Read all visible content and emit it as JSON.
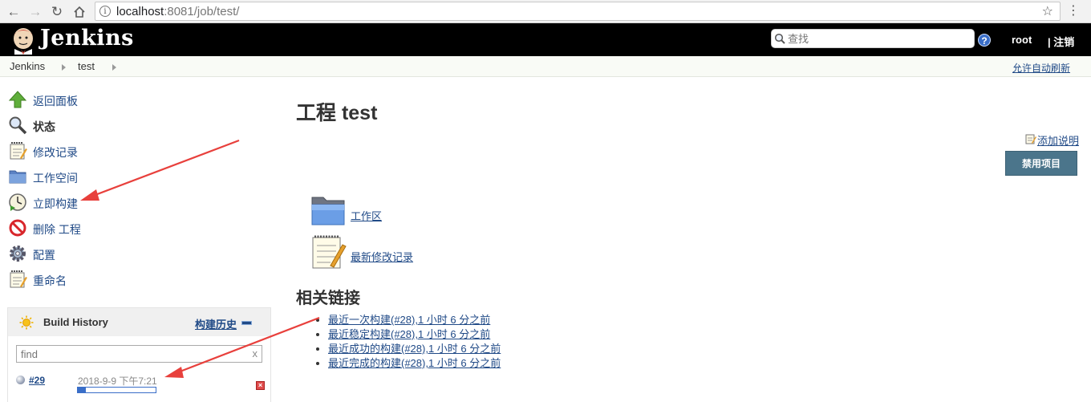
{
  "browser": {
    "url_host": "localhost",
    "url_rest": ":8081/job/test/"
  },
  "header": {
    "logo_text": "Jenkins",
    "search_placeholder": "查找",
    "help_label": "?",
    "user": "root",
    "logout": "| 注销"
  },
  "breadcrumb": {
    "items": [
      "Jenkins",
      "test"
    ],
    "auto_refresh": "允许自动刷新"
  },
  "sidepanel": {
    "tasks": [
      {
        "label": "返回面板",
        "icon": "up-arrow-icon"
      },
      {
        "label": "状态",
        "icon": "search-icon",
        "active": true
      },
      {
        "label": "修改记录",
        "icon": "notepad-icon"
      },
      {
        "label": "工作空间",
        "icon": "folder-icon"
      },
      {
        "label": "立即构建",
        "icon": "clock-icon"
      },
      {
        "label": "删除 工程",
        "icon": "no-entry-icon"
      },
      {
        "label": "配置",
        "icon": "gear-icon"
      },
      {
        "label": "重命名",
        "icon": "notepad-icon"
      }
    ]
  },
  "build_history": {
    "title": "Build History",
    "trend_label": "构建历史",
    "filter_placeholder": "find",
    "filter_clear": "x",
    "builds": [
      {
        "number": "#29",
        "date": "2018-9-9 下午7:21",
        "progress": 0.1
      }
    ]
  },
  "main": {
    "title": "工程 test",
    "add_description": "添加说明",
    "disable_button": "禁用项目",
    "workspace_link": "工作区",
    "changes_link": "最新修改记录",
    "permalinks_title": "相关链接",
    "permalinks": [
      "最近一次构建(#28),1 小时 6 分之前",
      "最近稳定构建(#28),1 小时 6 分之前",
      "最近成功的构建(#28),1 小时 6 分之前",
      "最近完成的构建(#28),1 小时 6 分之前"
    ]
  },
  "colors": {
    "accent_link": "#204a87",
    "header_bg": "#000000",
    "disable_button_bg": "#4b758b",
    "annotation_arrow": "#e8403c"
  }
}
